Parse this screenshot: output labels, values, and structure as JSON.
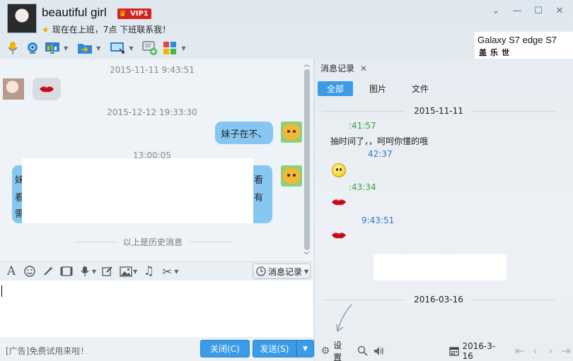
{
  "header": {
    "nickname": "beautiful girl",
    "vip_label": "VIP1",
    "signature": "现在在上班，7点 下班联系我！",
    "ad_line1": "Galaxy S7 edge  S7",
    "ad_line2": "盖 乐 世"
  },
  "window_controls": [
    "minimize-arrow",
    "minimize",
    "maximize",
    "close"
  ],
  "chat": {
    "timestamps": [
      "2015-11-11 9:43:51",
      "2015-12-12 19:33:30",
      "13:00:05"
    ],
    "message_right_1": "妹子在不、",
    "big_bubble_chars": [
      "妹",
      "看",
      "看",
      "有",
      "需"
    ],
    "history_divider": "以上是历史消息"
  },
  "input_toolbar": {
    "history_button": "消息记录"
  },
  "footer": {
    "ad_text": "[广告]免费试用来啦！",
    "close_button": "关闭(C)",
    "send_button": "发送(S)"
  },
  "right_pane": {
    "tab_title": "消息记录",
    "subtabs": [
      "全部",
      "图片",
      "文件"
    ],
    "date1": "2015-11-11",
    "time1": ":41:57",
    "text1": "抽时间了，，呵呵你懂的哦",
    "time2": "42:37",
    "time3": ":43:34",
    "time4": "9:43:51",
    "date2": "2016-03-16",
    "settings_label": "设置",
    "footer_date": "2016-3-16"
  },
  "colors": {
    "accent_blue": "#3c9be6",
    "bubble_blue": "#86c7f1",
    "time_green": "#3aa047",
    "time_blue": "#2a78c8",
    "vip_red": "#d6231f"
  }
}
